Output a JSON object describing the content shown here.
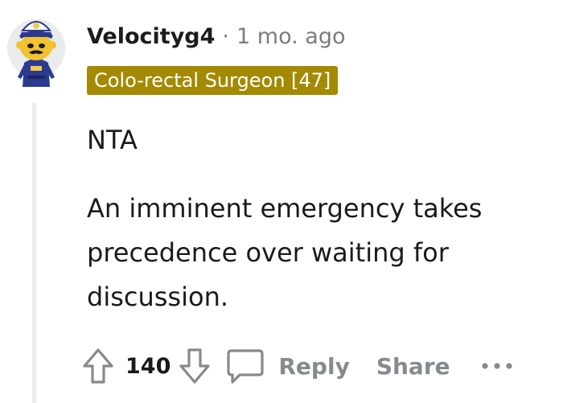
{
  "comment": {
    "author": "Velocityg4",
    "separator": "·",
    "timestamp": "1 mo. ago",
    "flair": "Colo-rectal Surgeon [47]",
    "flair_color": "#a38a02",
    "body": [
      "NTA",
      "An imminent emergency takes precedence over waiting for discussion."
    ],
    "avatar_icon": "snoo-police-avatar"
  },
  "actions": {
    "upvote_icon": "upvote-arrow-icon",
    "score": "140",
    "downvote_icon": "downvote-arrow-icon",
    "reply_icon": "speech-bubble-icon",
    "reply_label": "Reply",
    "share_label": "Share",
    "more_icon": "ellipsis-icon"
  }
}
